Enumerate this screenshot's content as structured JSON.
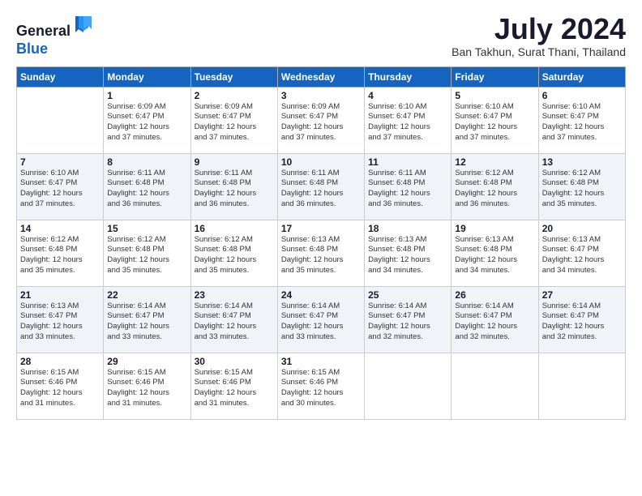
{
  "logo": {
    "line1": "General",
    "line2": "Blue"
  },
  "header": {
    "month": "July 2024",
    "location": "Ban Takhun, Surat Thani, Thailand"
  },
  "days_of_week": [
    "Sunday",
    "Monday",
    "Tuesday",
    "Wednesday",
    "Thursday",
    "Friday",
    "Saturday"
  ],
  "weeks": [
    {
      "row_class": "odd-row",
      "days": [
        {
          "num": "",
          "detail": ""
        },
        {
          "num": "1",
          "detail": "Sunrise: 6:09 AM\nSunset: 6:47 PM\nDaylight: 12 hours\nand 37 minutes."
        },
        {
          "num": "2",
          "detail": "Sunrise: 6:09 AM\nSunset: 6:47 PM\nDaylight: 12 hours\nand 37 minutes."
        },
        {
          "num": "3",
          "detail": "Sunrise: 6:09 AM\nSunset: 6:47 PM\nDaylight: 12 hours\nand 37 minutes."
        },
        {
          "num": "4",
          "detail": "Sunrise: 6:10 AM\nSunset: 6:47 PM\nDaylight: 12 hours\nand 37 minutes."
        },
        {
          "num": "5",
          "detail": "Sunrise: 6:10 AM\nSunset: 6:47 PM\nDaylight: 12 hours\nand 37 minutes."
        },
        {
          "num": "6",
          "detail": "Sunrise: 6:10 AM\nSunset: 6:47 PM\nDaylight: 12 hours\nand 37 minutes."
        }
      ]
    },
    {
      "row_class": "even-row",
      "days": [
        {
          "num": "7",
          "detail": "Sunrise: 6:10 AM\nSunset: 6:47 PM\nDaylight: 12 hours\nand 37 minutes."
        },
        {
          "num": "8",
          "detail": "Sunrise: 6:11 AM\nSunset: 6:48 PM\nDaylight: 12 hours\nand 36 minutes."
        },
        {
          "num": "9",
          "detail": "Sunrise: 6:11 AM\nSunset: 6:48 PM\nDaylight: 12 hours\nand 36 minutes."
        },
        {
          "num": "10",
          "detail": "Sunrise: 6:11 AM\nSunset: 6:48 PM\nDaylight: 12 hours\nand 36 minutes."
        },
        {
          "num": "11",
          "detail": "Sunrise: 6:11 AM\nSunset: 6:48 PM\nDaylight: 12 hours\nand 36 minutes."
        },
        {
          "num": "12",
          "detail": "Sunrise: 6:12 AM\nSunset: 6:48 PM\nDaylight: 12 hours\nand 36 minutes."
        },
        {
          "num": "13",
          "detail": "Sunrise: 6:12 AM\nSunset: 6:48 PM\nDaylight: 12 hours\nand 35 minutes."
        }
      ]
    },
    {
      "row_class": "odd-row",
      "days": [
        {
          "num": "14",
          "detail": "Sunrise: 6:12 AM\nSunset: 6:48 PM\nDaylight: 12 hours\nand 35 minutes."
        },
        {
          "num": "15",
          "detail": "Sunrise: 6:12 AM\nSunset: 6:48 PM\nDaylight: 12 hours\nand 35 minutes."
        },
        {
          "num": "16",
          "detail": "Sunrise: 6:12 AM\nSunset: 6:48 PM\nDaylight: 12 hours\nand 35 minutes."
        },
        {
          "num": "17",
          "detail": "Sunrise: 6:13 AM\nSunset: 6:48 PM\nDaylight: 12 hours\nand 35 minutes."
        },
        {
          "num": "18",
          "detail": "Sunrise: 6:13 AM\nSunset: 6:48 PM\nDaylight: 12 hours\nand 34 minutes."
        },
        {
          "num": "19",
          "detail": "Sunrise: 6:13 AM\nSunset: 6:48 PM\nDaylight: 12 hours\nand 34 minutes."
        },
        {
          "num": "20",
          "detail": "Sunrise: 6:13 AM\nSunset: 6:47 PM\nDaylight: 12 hours\nand 34 minutes."
        }
      ]
    },
    {
      "row_class": "even-row",
      "days": [
        {
          "num": "21",
          "detail": "Sunrise: 6:13 AM\nSunset: 6:47 PM\nDaylight: 12 hours\nand 33 minutes."
        },
        {
          "num": "22",
          "detail": "Sunrise: 6:14 AM\nSunset: 6:47 PM\nDaylight: 12 hours\nand 33 minutes."
        },
        {
          "num": "23",
          "detail": "Sunrise: 6:14 AM\nSunset: 6:47 PM\nDaylight: 12 hours\nand 33 minutes."
        },
        {
          "num": "24",
          "detail": "Sunrise: 6:14 AM\nSunset: 6:47 PM\nDaylight: 12 hours\nand 33 minutes."
        },
        {
          "num": "25",
          "detail": "Sunrise: 6:14 AM\nSunset: 6:47 PM\nDaylight: 12 hours\nand 32 minutes."
        },
        {
          "num": "26",
          "detail": "Sunrise: 6:14 AM\nSunset: 6:47 PM\nDaylight: 12 hours\nand 32 minutes."
        },
        {
          "num": "27",
          "detail": "Sunrise: 6:14 AM\nSunset: 6:47 PM\nDaylight: 12 hours\nand 32 minutes."
        }
      ]
    },
    {
      "row_class": "odd-row",
      "days": [
        {
          "num": "28",
          "detail": "Sunrise: 6:15 AM\nSunset: 6:46 PM\nDaylight: 12 hours\nand 31 minutes."
        },
        {
          "num": "29",
          "detail": "Sunrise: 6:15 AM\nSunset: 6:46 PM\nDaylight: 12 hours\nand 31 minutes."
        },
        {
          "num": "30",
          "detail": "Sunrise: 6:15 AM\nSunset: 6:46 PM\nDaylight: 12 hours\nand 31 minutes."
        },
        {
          "num": "31",
          "detail": "Sunrise: 6:15 AM\nSunset: 6:46 PM\nDaylight: 12 hours\nand 30 minutes."
        },
        {
          "num": "",
          "detail": ""
        },
        {
          "num": "",
          "detail": ""
        },
        {
          "num": "",
          "detail": ""
        }
      ]
    }
  ]
}
